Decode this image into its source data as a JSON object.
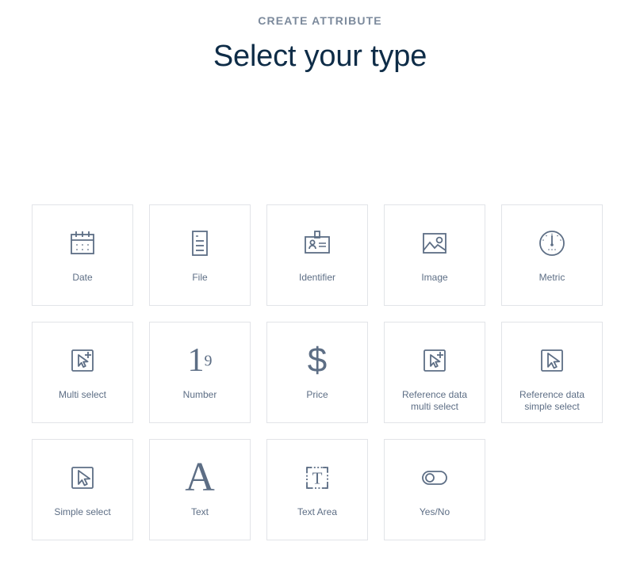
{
  "header": {
    "eyebrow": "CREATE ATTRIBUTE",
    "title": "Select your type"
  },
  "colors": {
    "title": "#0e2c47",
    "eyebrow": "#7c8a9c",
    "icon": "#5d6e85",
    "label": "#5d6e85",
    "card_border": "#e2e4e8",
    "background": "#ffffff"
  },
  "grid": {
    "rows": [
      {
        "cards": [
          {
            "label": "Date",
            "icon": "calendar-icon"
          },
          {
            "label": "File",
            "icon": "document-icon"
          },
          {
            "label": "Identifier",
            "icon": "id-badge-icon"
          },
          {
            "label": "Image",
            "icon": "picture-icon"
          },
          {
            "label": "Metric",
            "icon": "gauge-icon"
          }
        ]
      },
      {
        "cards": [
          {
            "label": "Multi select",
            "icon": "cursor-plus-box-icon"
          },
          {
            "label": "Number",
            "icon": "number-one-nine-glyph"
          },
          {
            "label": "Price",
            "icon": "dollar-sign-glyph"
          },
          {
            "label": "Reference data\nmulti select",
            "icon": "cursor-plus-box-icon"
          },
          {
            "label": "Reference data\nsimple select",
            "icon": "cursor-box-icon"
          }
        ]
      },
      {
        "cards": [
          {
            "label": "Simple select",
            "icon": "cursor-box-icon"
          },
          {
            "label": "Text",
            "icon": "letter-a-glyph"
          },
          {
            "label": "Text Area",
            "icon": "text-area-icon"
          },
          {
            "label": "Yes/No",
            "icon": "toggle-off-icon"
          }
        ]
      }
    ]
  }
}
